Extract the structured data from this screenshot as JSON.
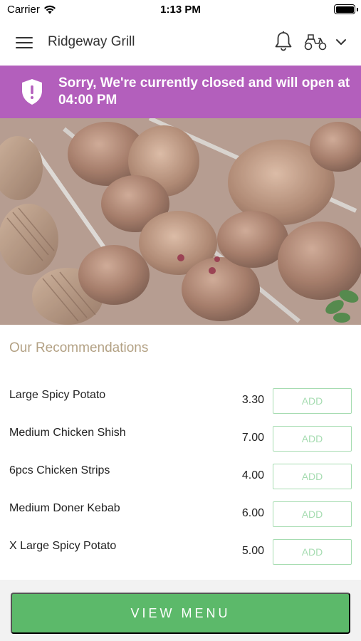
{
  "status_bar": {
    "carrier": "Carrier",
    "time": "1:13 PM"
  },
  "header": {
    "title": "Ridgeway Grill",
    "icons": [
      "hamburger-menu-icon",
      "bell-icon",
      "scooter-icon",
      "chevron-down-icon"
    ]
  },
  "banner": {
    "message": "Sorry, We're currently closed and will open at 04:00 PM",
    "color": "#b35fbc",
    "icon": "shield-alert-icon"
  },
  "hero": {
    "icon": "grill-skewers-photo"
  },
  "recommendations": {
    "title": "Our Recommendations",
    "items": [
      {
        "name": "Large Spicy Potato",
        "price": "3.30",
        "action": "ADD"
      },
      {
        "name": "Medium Chicken Shish",
        "price": "7.00",
        "action": "ADD"
      },
      {
        "name": "6pcs Chicken Strips",
        "price": "4.00",
        "action": "ADD"
      },
      {
        "name": "Medium Doner Kebab",
        "price": "6.00",
        "action": "ADD"
      },
      {
        "name": "X Large Spicy Potato",
        "price": "5.00",
        "action": "ADD"
      }
    ]
  },
  "footer": {
    "button_label": "VIEW MENU",
    "accent": "#5cb96a"
  }
}
